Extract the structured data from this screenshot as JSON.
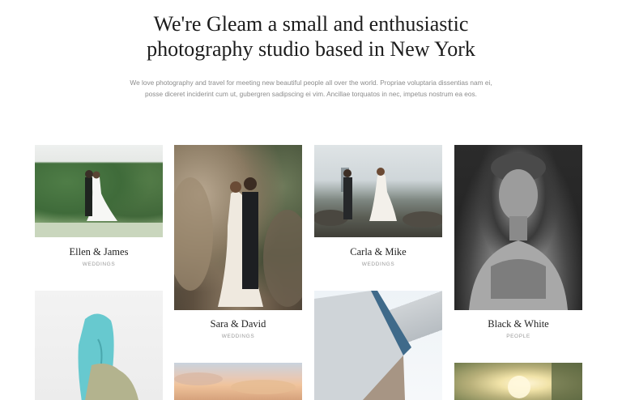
{
  "hero": {
    "title_line1": "We're Gleam a small and enthusiastic",
    "title_line2": "photography studio based in New York",
    "description_line1": "We love photography and travel for meeting new beautiful people all over the world. Propriae voluptaria dissentias nam ei,",
    "description_line2": "posse diceret inciderint cum ut, gubergren sadipscing ei vim. Ancillae torquatos in nec, impetus nostrum ea eos."
  },
  "portfolio": [
    {
      "title": "Ellen & James",
      "category": "WEDDINGS"
    },
    {
      "title": "Sara & David",
      "category": "WEDDINGS"
    },
    {
      "title": "Carla & Mike",
      "category": "WEDDINGS"
    },
    {
      "title": "Black & White",
      "category": "PEOPLE"
    }
  ]
}
